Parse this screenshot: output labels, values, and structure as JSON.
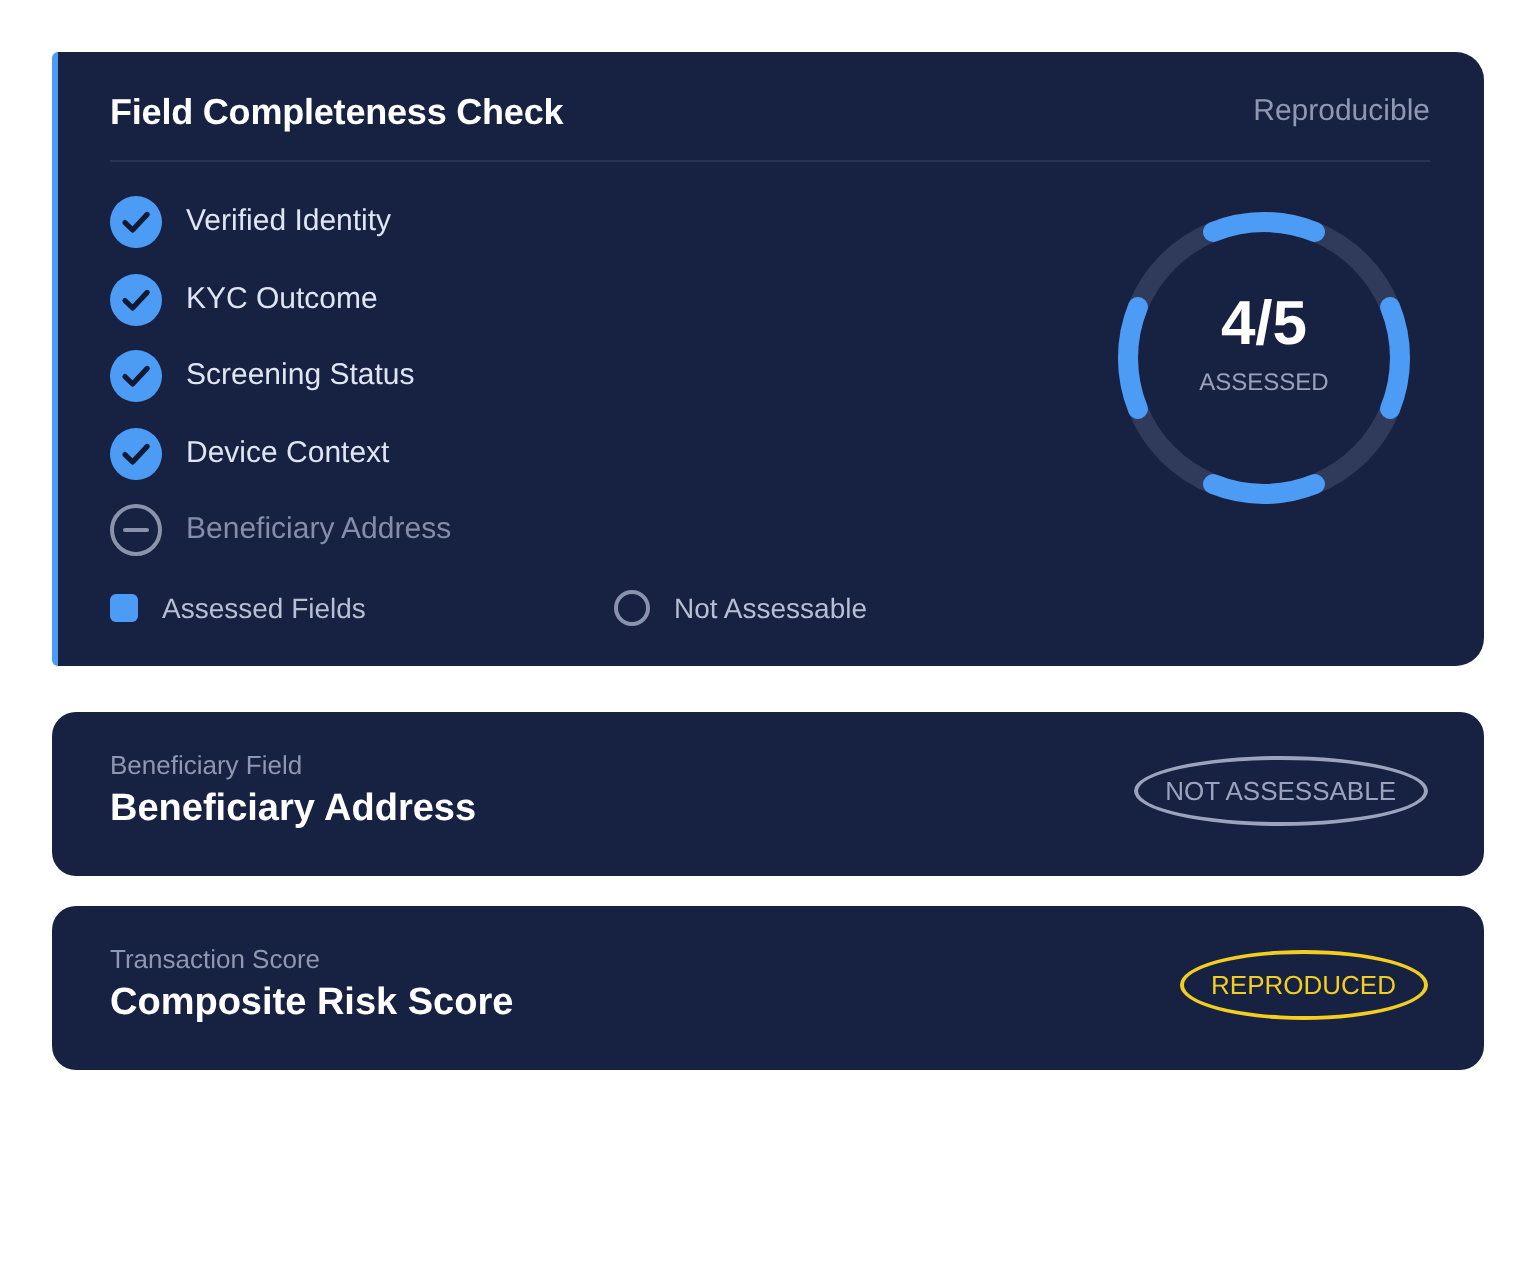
{
  "summary": {
    "title": "Field Completeness Check",
    "tag": "Reproducible",
    "checklist": [
      {
        "label": "Verified Identity",
        "checked": true
      },
      {
        "label": "KYC Outcome",
        "checked": true
      },
      {
        "label": "Screening Status",
        "checked": true
      },
      {
        "label": "Device Context",
        "checked": true
      },
      {
        "label": "Beneficiary Address",
        "checked": false
      }
    ],
    "legend": [
      {
        "kind": "square",
        "label": "Assessed Fields"
      },
      {
        "kind": "ring",
        "label": "Not Assessable"
      }
    ],
    "gauge": {
      "value": "4/5",
      "caption": "ASSESSED"
    }
  },
  "fields": [
    {
      "label": "Beneficiary Field",
      "title": "Beneficiary Address",
      "status": {
        "kind": "not_assessable",
        "text": "NOT ASSESSABLE"
      }
    },
    {
      "label": "Transaction Score",
      "title": "Composite Risk Score",
      "status": {
        "kind": "reproduced",
        "text": "REPRODUCED"
      }
    }
  ]
}
